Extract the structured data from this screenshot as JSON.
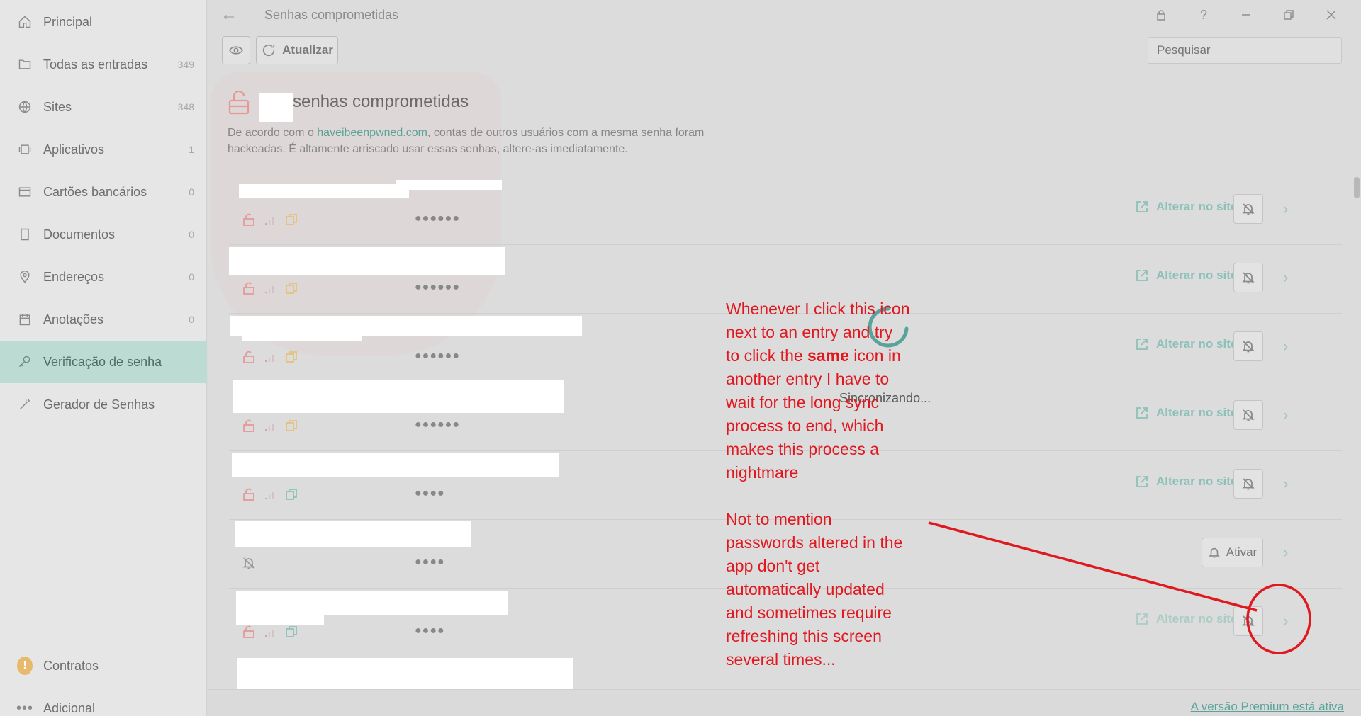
{
  "sidebar": {
    "items": [
      {
        "label": "Principal",
        "icon": "home-icon",
        "count": ""
      },
      {
        "label": "Todas as entradas",
        "icon": "folder-icon",
        "count": "349"
      },
      {
        "label": "Sites",
        "icon": "globe-icon",
        "count": "348"
      },
      {
        "label": "Aplicativos",
        "icon": "app-icon",
        "count": "1"
      },
      {
        "label": "Cartões bancários",
        "icon": "card-icon",
        "count": "0"
      },
      {
        "label": "Documentos",
        "icon": "document-icon",
        "count": "0"
      },
      {
        "label": "Endereços",
        "icon": "pin-icon",
        "count": "0"
      },
      {
        "label": "Anotações",
        "icon": "note-icon",
        "count": "0"
      },
      {
        "label": "Verificação de senha",
        "icon": "key-icon",
        "count": ""
      },
      {
        "label": "Gerador de Senhas",
        "icon": "wand-icon",
        "count": ""
      }
    ],
    "bottom": [
      {
        "label": "Contratos",
        "icon": "warning-icon"
      },
      {
        "label": "Adicional",
        "icon": "more-icon"
      }
    ]
  },
  "titlebar": {
    "title": "Senhas comprometidas"
  },
  "toolbar": {
    "refresh_label": "Atualizar",
    "search_placeholder": "Pesquisar"
  },
  "header": {
    "title": "senhas comprometidas",
    "desc_before": "De acordo com o ",
    "desc_link": "haveibeenpwned.com",
    "desc_after": ", contas de outros usuários com a mesma senha foram hackeadas. É altamente arriscado usar essas senhas, altere-as imediatamente."
  },
  "rows": [
    {
      "dots": "●●●●●●",
      "action": "Alterar no site",
      "muted": false
    },
    {
      "dots": "●●●●●●",
      "action": "Alterar no site",
      "muted": false
    },
    {
      "dots": "●●●●●●",
      "action": "Alterar no site",
      "muted": false
    },
    {
      "dots": "●●●●●●",
      "action": "Alterar no site",
      "muted": false
    },
    {
      "dots": "●●●●",
      "action": "Alterar no site",
      "muted": false
    },
    {
      "dots": "●●●●",
      "action": "Ativar",
      "muted": true
    },
    {
      "dots": "●●●●",
      "action": "Alterar no site",
      "muted": false
    }
  ],
  "sync": {
    "text": "Sincronizando..."
  },
  "annotation": {
    "line1": "Whenever I click this icon",
    "line2": "next to an entry and try",
    "line3_a": "to click the ",
    "line3_bold": "same",
    "line3_b": " icon in",
    "line4": "another entry I have to",
    "line5": "wait for the long sync",
    "line6": "process to end, which",
    "line7": "makes this process a",
    "line8": "nightmare",
    "p2_line1": "Not to mention",
    "p2_line2": "passwords altered in the",
    "p2_line3": "app don't get",
    "p2_line4": "automatically updated",
    "p2_line5": "and sometimes require",
    "p2_line6": "refreshing this screen",
    "p2_line7": "several times..."
  },
  "footer": {
    "premium": "A versão Premium está ativa"
  },
  "colors": {
    "accent": "#5aa39a",
    "annotation": "#e0181f",
    "danger": "#e59a9a",
    "warning": "#e8b96a"
  }
}
